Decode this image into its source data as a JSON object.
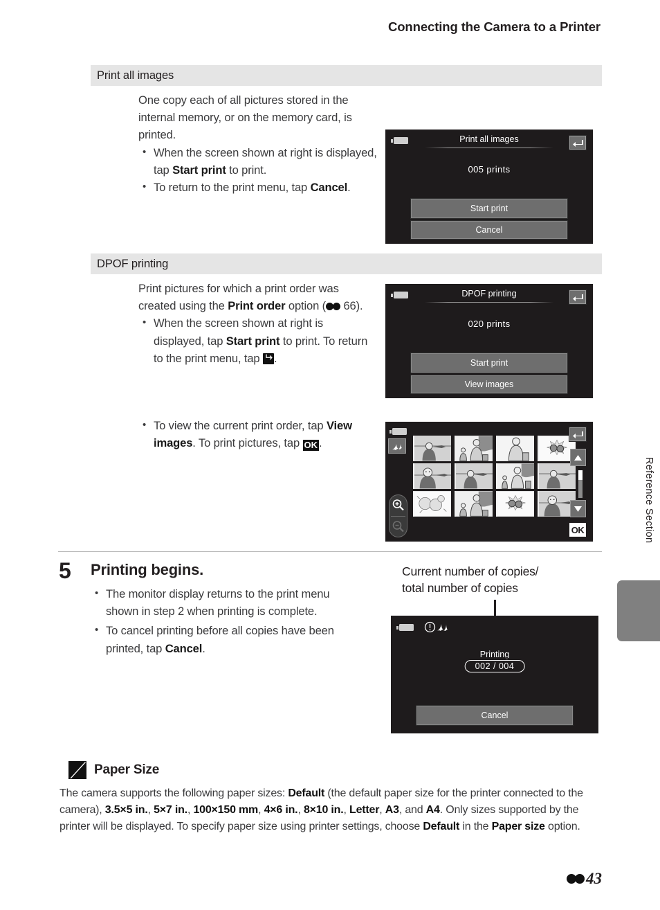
{
  "running_head": "Connecting the Camera to a Printer",
  "sections": [
    {
      "heading": "Print all images"
    },
    {
      "heading": "DPOF printing"
    }
  ],
  "print_all_images": {
    "intro": "One copy each of all pictures stored in the internal memory, or on the memory card, is printed.",
    "bullet1_a": "When the screen shown at right is displayed, tap ",
    "bullet1_b": "Start print",
    "bullet1_c": " to print.",
    "bullet2_a": "To return to the print menu, tap ",
    "bullet2_b": "Cancel",
    "bullet2_c": "."
  },
  "dpof_printing": {
    "para_a": "Print pictures for which a print order was created using the ",
    "para_b": "Print order",
    "para_c": " option (",
    "para_page": " 66).",
    "bullet1_a": "When the screen shown at right is displayed, tap ",
    "bullet1_b": "Start print",
    "bullet1_c": " to print. To return to the print menu, tap ",
    "bullet1_d": ".",
    "bullet2_a": "To view the current print order, tap ",
    "bullet2_b": "View images",
    "bullet2_c": ". To print pictures, tap ",
    "bullet2_d": "."
  },
  "screen_print_all": {
    "title": "Print all images",
    "count": "005  prints",
    "button_primary": "Start print",
    "button_secondary": "Cancel",
    "back_icon": "back-arrow-icon",
    "battery_icon": "battery-icon"
  },
  "screen_dpof": {
    "title": "DPOF printing",
    "count": "020  prints",
    "button_primary": "Start print",
    "button_secondary": "View images",
    "back_icon": "back-arrow-icon",
    "battery_icon": "battery-icon"
  },
  "screen_thumbnails": {
    "back_icon": "back-arrow-icon",
    "up_icon": "triangle-up-icon",
    "down_icon": "triangle-down-icon",
    "ok_label": "OK",
    "zoom_in_icon": "magnifier-plus-icon",
    "zoom_out_icon": "magnifier-minus-icon",
    "print_mode_icon": "print-order-icon",
    "battery_icon": "battery-icon",
    "thumbnail_count": 12,
    "thumbnails": [
      "scene-beach-person",
      "scene-family-two",
      "scene-woman-bag",
      "scene-flowers-burst",
      "scene-woman-smile",
      "scene-beach-person",
      "scene-family-three",
      "scene-beach-person",
      "scene-flowers-cluster",
      "scene-family-two",
      "scene-flowers-burst",
      "scene-woman-smile"
    ]
  },
  "step5": {
    "number": "5",
    "title": "Printing begins.",
    "bullet1": "The monitor display returns to the print menu shown in step 2 when printing is complete.",
    "bullet2_a": "To cancel printing before all copies have been printed, tap ",
    "bullet2_b": "Cancel",
    "bullet2_c": "."
  },
  "callout": {
    "line1": "Current number of copies/",
    "line2": "total number of copies"
  },
  "screen_printing": {
    "status": "Printing",
    "counter": "002 / 004",
    "button": "Cancel",
    "battery_icon": "battery-icon",
    "warning_icon": "warning-circle-icon",
    "print_icon": "print-order-icon"
  },
  "note": {
    "icon": "pencil-note-icon",
    "title": "Paper Size",
    "t1": "The camera supports the following paper sizes: ",
    "b1": "Default",
    "t2": " (the default paper size for the printer connected to the camera), ",
    "b2": "3.5×5 in.",
    "t3": ", ",
    "b3": "5×7 in.",
    "t4": ", ",
    "b4": "100×150 mm",
    "t5": ", ",
    "b5": "4×6 in.",
    "t6": ", ",
    "b6": "8×10 in.",
    "t7": ", ",
    "b7": "Letter",
    "t8": ", ",
    "b8": "A3",
    "t9": ", and ",
    "b9": "A4",
    "t10": ". Only sizes supported by the printer will be displayed. To specify paper size using printer settings, choose ",
    "b10": "Default",
    "t11": " in the ",
    "b11": "Paper size",
    "t12": " option."
  },
  "side_tab": {
    "label": "Reference Section"
  },
  "footer": {
    "page_number": "43",
    "symbol": "reference-section-symbol"
  },
  "colors": {
    "screen_background": "#1e1b1c",
    "button_gray": "#6e6e6e",
    "section_bar": "#e5e5e5",
    "side_tab": "#808080",
    "text": "#3b3b3d"
  }
}
